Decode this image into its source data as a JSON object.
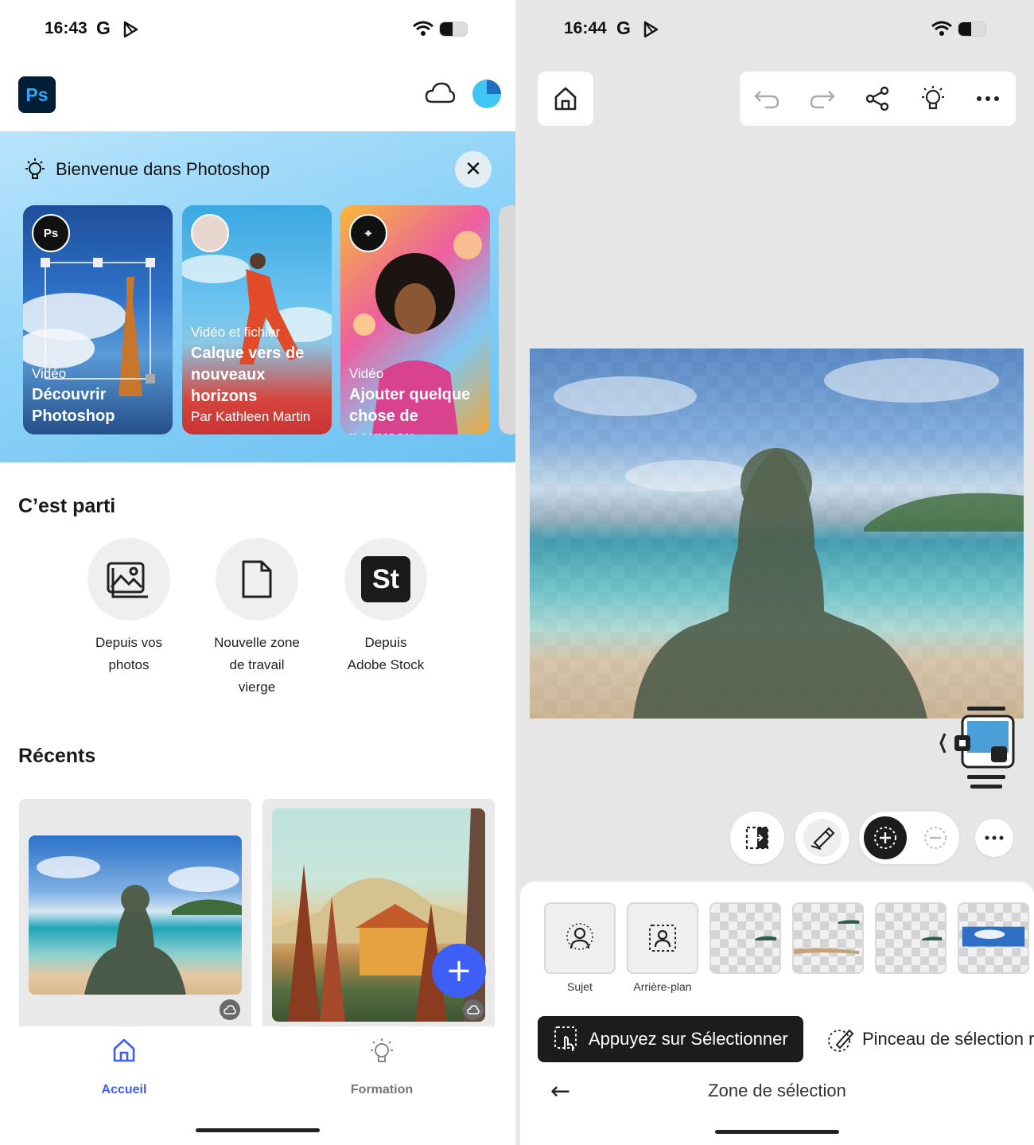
{
  "left": {
    "status": {
      "time": "16:43",
      "g": "G"
    },
    "header": {
      "app_logo": "Ps"
    },
    "banner": {
      "title": "Bienvenue dans Photoshop",
      "cards": [
        {
          "badge": "Ps",
          "kind": "Vidéo",
          "title_line1": "Découvrir",
          "title_line2": "Photoshop"
        },
        {
          "kind": "Vidéo et fichier",
          "title_line1": "Calque vers de",
          "title_line2": "nouveaux",
          "title_line3": "horizons",
          "author": "Par Kathleen Martin"
        },
        {
          "kind": "Vidéo",
          "title_line1": "Ajouter quelque",
          "title_line2": "chose de nouveau"
        }
      ]
    },
    "start": {
      "title": "C’est parti",
      "actions": [
        {
          "line1": "Depuis vos",
          "line2": "photos"
        },
        {
          "line1": "Nouvelle zone",
          "line2": "de travail",
          "line3": "vierge",
          "logo": ""
        },
        {
          "line1": "Depuis",
          "line2": "Adobe Stock",
          "logo": "St"
        }
      ]
    },
    "recents": {
      "title": "Récents"
    },
    "nav": {
      "home": "Accueil",
      "learn": "Formation"
    }
  },
  "right": {
    "status": {
      "time": "16:44",
      "g": "G"
    },
    "tiles": {
      "subject": "Sujet",
      "background": "Arrière-plan"
    },
    "tap_select": "Appuyez sur Sélectionner",
    "brush_select": "Pinceau de sélection r",
    "zone_title": "Zone de sélection"
  },
  "colors": {
    "accent": "#3d5ff5",
    "ps_dark": "#001e36",
    "ps_blue": "#31a8ff"
  }
}
